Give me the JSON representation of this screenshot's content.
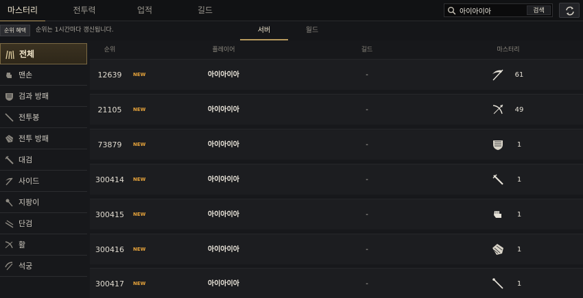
{
  "nav": {
    "tabs": [
      {
        "label": "마스터리",
        "active": true
      },
      {
        "label": "전투력",
        "active": false
      },
      {
        "label": "업적",
        "active": false
      },
      {
        "label": "길드",
        "active": false
      }
    ]
  },
  "search": {
    "value": "아이아이아",
    "button_label": "검색",
    "icon": "search-icon"
  },
  "refresh": {
    "icon": "refresh-icon"
  },
  "info": {
    "benefit_label": "순위 혜택",
    "update_text": "순위는 1시간마다 갱신됩니다."
  },
  "scope_tabs": [
    {
      "label": "서버",
      "active": true
    },
    {
      "label": "월드",
      "active": false
    }
  ],
  "sidebar": {
    "items": [
      {
        "label": "전체",
        "icon": "all-weapons-icon",
        "active": true
      },
      {
        "label": "맨손",
        "icon": "fist-icon",
        "active": false
      },
      {
        "label": "검과 방패",
        "icon": "sword-shield-icon",
        "active": false
      },
      {
        "label": "전투봉",
        "icon": "battle-staff-icon",
        "active": false
      },
      {
        "label": "전투 방패",
        "icon": "battle-shield-icon",
        "active": false
      },
      {
        "label": "대검",
        "icon": "greatsword-icon",
        "active": false
      },
      {
        "label": "사이드",
        "icon": "scythe-icon",
        "active": false
      },
      {
        "label": "지팡이",
        "icon": "wand-icon",
        "active": false
      },
      {
        "label": "단검",
        "icon": "dagger-icon",
        "active": false
      },
      {
        "label": "활",
        "icon": "bow-icon",
        "active": false
      },
      {
        "label": "석궁",
        "icon": "crossbow-icon",
        "active": false
      }
    ]
  },
  "table": {
    "headers": {
      "rank": "순위",
      "player": "플레이어",
      "guild": "길드",
      "mastery": "마스터리"
    },
    "rows": [
      {
        "rank": "12639",
        "badge": "NEW",
        "player": "아이아이아",
        "guild": "-",
        "mastery": "61",
        "icon": "scythe-icon"
      },
      {
        "rank": "21105",
        "badge": "NEW",
        "player": "아이아이아",
        "guild": "-",
        "mastery": "49",
        "icon": "bow-icon"
      },
      {
        "rank": "73879",
        "badge": "NEW",
        "player": "아이아이아",
        "guild": "-",
        "mastery": "1",
        "icon": "sword-shield-icon"
      },
      {
        "rank": "300414",
        "badge": "NEW",
        "player": "아이아이아",
        "guild": "-",
        "mastery": "1",
        "icon": "greatsword-icon"
      },
      {
        "rank": "300415",
        "badge": "NEW",
        "player": "아이아이아",
        "guild": "-",
        "mastery": "1",
        "icon": "fist-icon"
      },
      {
        "rank": "300416",
        "badge": "NEW",
        "player": "아이아이아",
        "guild": "-",
        "mastery": "1",
        "icon": "battle-shield-icon"
      },
      {
        "rank": "300417",
        "badge": "NEW",
        "player": "아이아이아",
        "guild": "-",
        "mastery": "1",
        "icon": "battle-staff-icon"
      }
    ]
  },
  "colors": {
    "accent": "#b89a5e",
    "new_badge": "#e7a43b",
    "background": "#17181b"
  }
}
